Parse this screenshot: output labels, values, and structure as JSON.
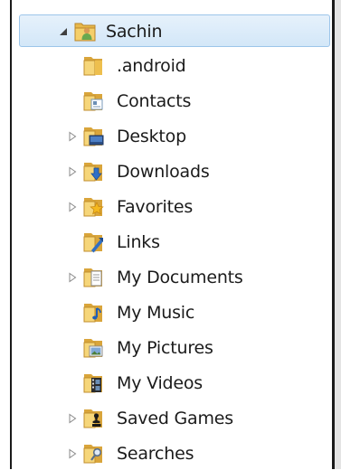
{
  "tree": {
    "items": [
      {
        "label": "Sachin",
        "icon": "user-folder-icon",
        "expander": "expanded",
        "selected": true
      },
      {
        "label": ".android",
        "icon": "folder-icon",
        "expander": "none"
      },
      {
        "label": "Contacts",
        "icon": "contacts-folder-icon",
        "expander": "none"
      },
      {
        "label": "Desktop",
        "icon": "desktop-folder-icon",
        "expander": "collapsed"
      },
      {
        "label": "Downloads",
        "icon": "downloads-folder-icon",
        "expander": "collapsed"
      },
      {
        "label": "Favorites",
        "icon": "favorites-folder-icon",
        "expander": "collapsed"
      },
      {
        "label": "Links",
        "icon": "links-folder-icon",
        "expander": "none"
      },
      {
        "label": "My Documents",
        "icon": "documents-folder-icon",
        "expander": "collapsed"
      },
      {
        "label": "My Music",
        "icon": "music-folder-icon",
        "expander": "none"
      },
      {
        "label": "My Pictures",
        "icon": "pictures-folder-icon",
        "expander": "none"
      },
      {
        "label": "My Videos",
        "icon": "videos-folder-icon",
        "expander": "none"
      },
      {
        "label": "Saved Games",
        "icon": "saved-games-folder-icon",
        "expander": "collapsed"
      },
      {
        "label": "Searches",
        "icon": "searches-folder-icon",
        "expander": "collapsed"
      }
    ]
  },
  "colors": {
    "selection_fill": "#d9eaf9",
    "selection_border": "#9cc5ea",
    "folder": "#e8b84a",
    "text": "#1b1b1b"
  }
}
